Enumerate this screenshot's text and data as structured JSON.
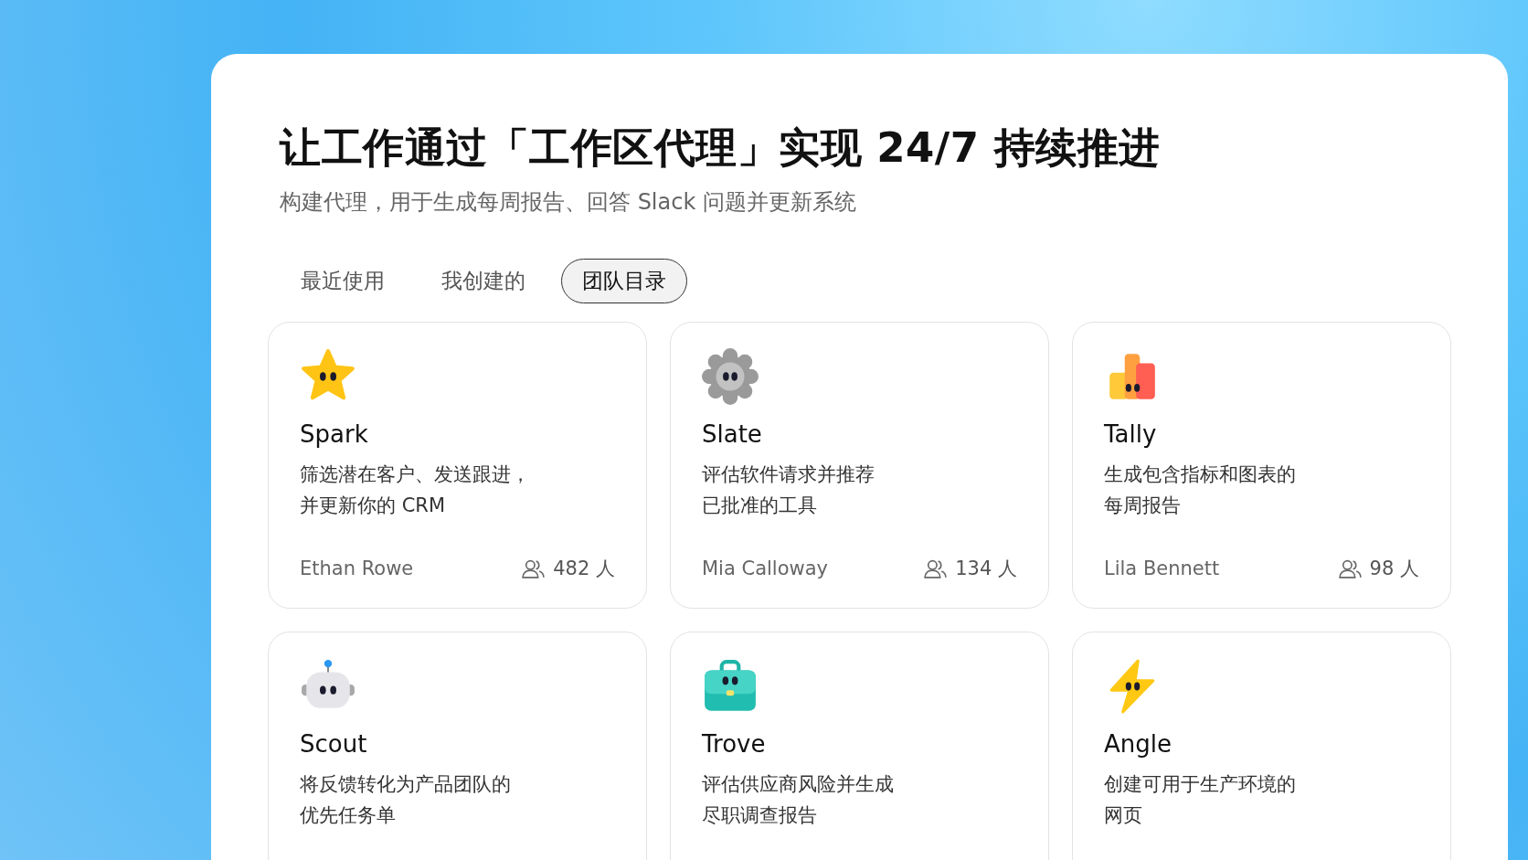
{
  "header": {
    "title": "让工作通过「工作区代理」实现 24/7 持续推进",
    "subtitle": "构建代理，用于生成每周报告、回答 Slack 问题并更新系统"
  },
  "tabs": [
    {
      "label": "最近使用",
      "selected": false
    },
    {
      "label": "我创建的",
      "selected": false
    },
    {
      "label": "团队目录",
      "selected": true
    }
  ],
  "agents": [
    {
      "kind": "star",
      "name": "Spark",
      "description": [
        "筛选潜在客户、发送跟进，",
        "并更新你的 CRM"
      ],
      "author": "Ethan Rowe",
      "users": "482 人"
    },
    {
      "kind": "gear",
      "name": "Slate",
      "description": [
        "评估软件请求并推荐",
        "已批准的工具"
      ],
      "author": "Mia Calloway",
      "users": "134 人"
    },
    {
      "kind": "bars",
      "name": "Tally",
      "description": [
        "生成包含指标和图表的",
        "每周报告"
      ],
      "author": "Lila Bennett",
      "users": "98 人"
    },
    {
      "kind": "robot",
      "name": "Scout",
      "description": [
        "将反馈转化为产品团队的",
        "优先任务单"
      ]
    },
    {
      "kind": "briefcase",
      "name": "Trove",
      "description": [
        "评估供应商风险并生成",
        "尽职调查报告"
      ]
    },
    {
      "kind": "bolt",
      "name": "Angle",
      "description": [
        "创建可用于生产环境的",
        "网页"
      ]
    }
  ]
}
